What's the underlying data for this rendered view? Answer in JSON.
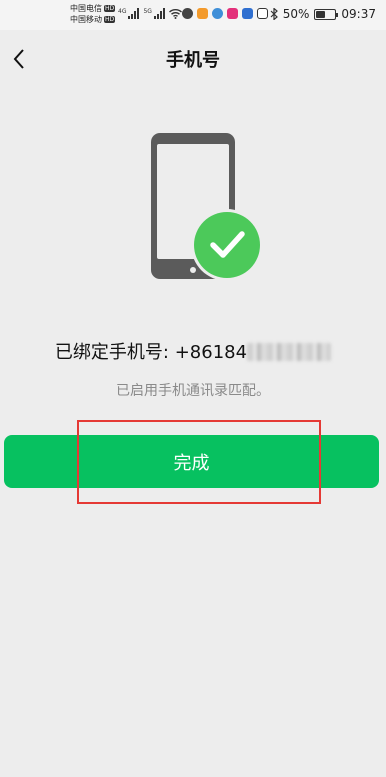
{
  "status_bar": {
    "carrier1": "中国电信",
    "carrier2": "中国移动",
    "hd_badge": "HD",
    "net1": "4G",
    "net2": "5G",
    "battery": "50%",
    "battery_level": 0.5,
    "time": "09:37"
  },
  "nav": {
    "title": "手机号",
    "back_icon": "chevron-left-icon"
  },
  "illustration": {
    "icon": "phone-verified-icon",
    "check_color": "#4cc95a",
    "phone_color": "#5b5b5b"
  },
  "bound_label": "已绑定手机号: +86184",
  "hint": "已启用手机通讯录匹配。",
  "done_button": {
    "label": "完成",
    "color": "#07c160"
  },
  "annotation": {
    "color": "#e53935"
  }
}
